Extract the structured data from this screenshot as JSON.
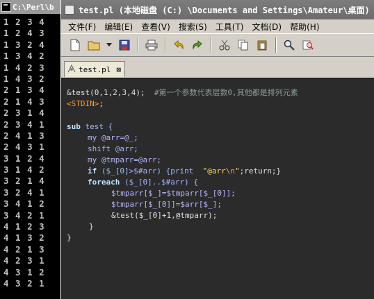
{
  "console": {
    "title": "C:\\Perl\\b",
    "lines": [
      "1 2 3 4",
      "1 2 4 3",
      "1 3 2 4",
      "1 3 4 2",
      "1 4 2 3",
      "1 4 3 2",
      "2 1 3 4",
      "2 1 4 3",
      "2 3 1 4",
      "2 3 4 1",
      "2 4 1 3",
      "2 4 3 1",
      "3 1 2 4",
      "3 1 4 2",
      "3 2 1 4",
      "3 2 4 1",
      "3 4 1 2",
      "3 4 2 1",
      "4 1 2 3",
      "4 1 3 2",
      "4 2 1 3",
      "4 2 3 1",
      "4 3 1 2",
      "4 3 2 1"
    ]
  },
  "editor": {
    "title": "test.pl (本地磁盘 (C:) \\Documents and Settings\\Amateur\\桌面) ",
    "menu": [
      "文件(F)",
      "编辑(E)",
      "查看(V)",
      "搜索(S)",
      "工具(T)",
      "文档(D)",
      "帮助(H)"
    ],
    "toolbar": [
      "new-file",
      "open-file",
      "open-dropdown",
      "save",
      "print",
      "undo",
      "redo",
      "cut",
      "copy",
      "paste",
      "find",
      "replace"
    ],
    "tab": {
      "label": "test.pl",
      "close": "⊠"
    },
    "code": {
      "l1_a": "&test(0,1,2,3,4);",
      "l1_comment": "#第一个参数代表层数0,其他都是排列元素",
      "l2_stdin": "<STDIN>",
      "l2_end": ";",
      "l4_kw": "sub",
      "l4_name": "test {",
      "l5": "my @arr=@_;",
      "l6": "shift @arr;",
      "l7": "my @tmparr=@arr;",
      "l8_if": "if",
      "l8_cond": "($_[0]>$#arr) {print",
      "l8_str": "\"@arr",
      "l8_esc": "\\n",
      "l8_strend": "\"",
      "l8_tail": ";return;}",
      "l9_kw": "foreach",
      "l9_rest": "($_[0]..$#arr) {",
      "l10": "$tmparr[$_]=$tmparr[$_[0]];",
      "l11": "$tmparr[$_[0]]=$arr[$_];",
      "l12": "&test($_[0]+1,@tmparr);",
      "l13": "}",
      "l14": "}"
    }
  }
}
